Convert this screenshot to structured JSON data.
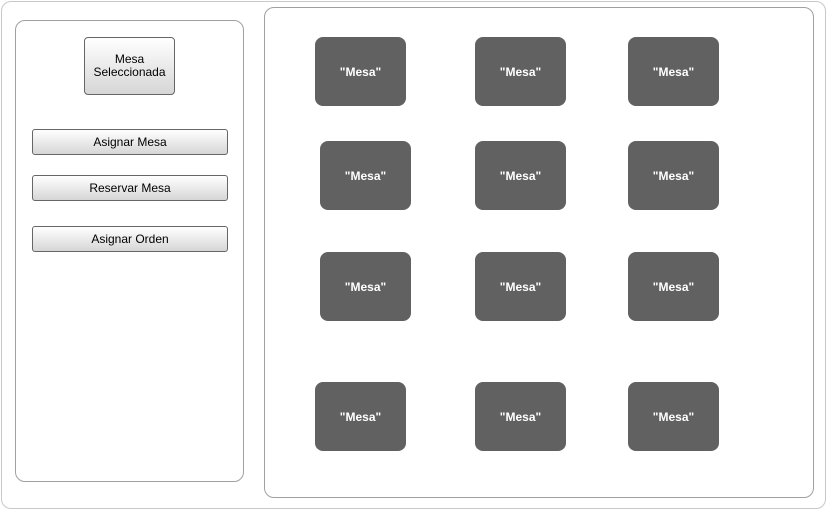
{
  "left_panel": {
    "selected_label": "Mesa Seleccionada",
    "buttons": {
      "assign_table": "Asignar Mesa",
      "reserve_table": "Reservar Mesa",
      "assign_order": "Asignar Orden"
    }
  },
  "tables": [
    {
      "label": "\"Mesa\""
    },
    {
      "label": "\"Mesa\""
    },
    {
      "label": "\"Mesa\""
    },
    {
      "label": "\"Mesa\""
    },
    {
      "label": "\"Mesa\""
    },
    {
      "label": "\"Mesa\""
    },
    {
      "label": "\"Mesa\""
    },
    {
      "label": "\"Mesa\""
    },
    {
      "label": "\"Mesa\""
    },
    {
      "label": "\"Mesa\""
    },
    {
      "label": "\"Mesa\""
    },
    {
      "label": "\"Mesa\""
    }
  ],
  "colors": {
    "table_fill": "#616161",
    "table_text": "#ffffff",
    "panel_border": "#a0a0a0"
  }
}
